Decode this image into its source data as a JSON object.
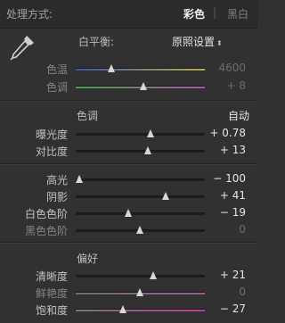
{
  "header": {
    "label": "处理方式:",
    "treatment_color": "彩色",
    "separator": "|",
    "treatment_bw": "黑白"
  },
  "white_balance": {
    "label": "白平衡:",
    "value": "原照设置",
    "chevron": "⬍",
    "eyedropper_icon": "eyedropper-icon"
  },
  "wb_sliders": [
    {
      "label": "色温",
      "value": "4600",
      "position": 0.28,
      "active": false,
      "track": "temp"
    },
    {
      "label": "色调",
      "value": "+ 8",
      "position": 0.53,
      "active": false,
      "track": "tint"
    }
  ],
  "tone": {
    "title": "色调",
    "auto_label": "自动",
    "sliders": [
      {
        "label": "曝光度",
        "value": "+ 0.78",
        "position": 0.58,
        "active": true
      },
      {
        "label": "对比度",
        "value": "+ 13",
        "position": 0.565,
        "active": true
      }
    ],
    "tone_sliders": [
      {
        "label": "高光",
        "value": "− 100",
        "position": 0.03,
        "active": true
      },
      {
        "label": "阴影",
        "value": "+ 41",
        "position": 0.7,
        "active": true
      },
      {
        "label": "白色色阶",
        "value": "− 19",
        "position": 0.41,
        "active": true
      },
      {
        "label": "黑色色阶",
        "value": "0",
        "position": 0.5,
        "active": false
      }
    ]
  },
  "presence": {
    "title": "偏好",
    "sliders": [
      {
        "label": "清晰度",
        "value": "+ 21",
        "position": 0.6,
        "active": true,
        "track": "plain"
      },
      {
        "label": "鲜艳度",
        "value": "0",
        "position": 0.5,
        "active": false,
        "track": "vib"
      },
      {
        "label": "饱和度",
        "value": "− 27",
        "position": 0.37,
        "active": true,
        "track": "sat"
      }
    ]
  }
}
